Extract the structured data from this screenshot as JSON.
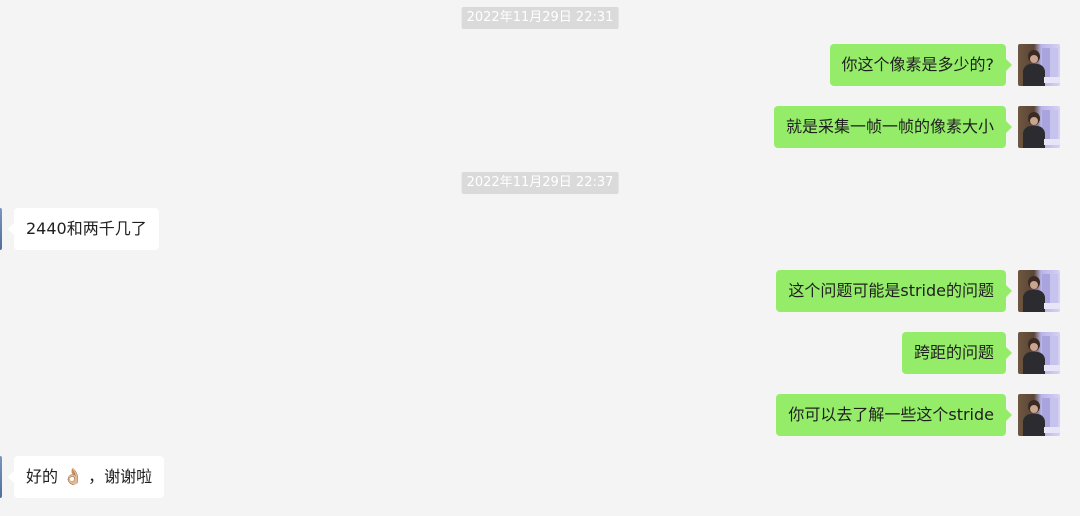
{
  "timestamps": [
    "2022年11月29日 22:31",
    "2022年11月29日 22:37"
  ],
  "messages": [
    {
      "side": "out",
      "text": "你这个像素是多少的?"
    },
    {
      "side": "out",
      "text": "就是采集一帧一帧的像素大小"
    },
    {
      "side": "in",
      "text": "2440和两千几了"
    },
    {
      "side": "out",
      "text": "这个问题可能是stride的问题"
    },
    {
      "side": "out",
      "text": "跨距的问题"
    },
    {
      "side": "out",
      "text": "你可以去了解一些这个stride"
    },
    {
      "side": "in",
      "text_before": "好的",
      "emoji": "👌🏼",
      "text_after": "，谢谢啦"
    }
  ],
  "colors": {
    "outgoing_bubble": "#95ec69",
    "incoming_bubble": "#ffffff",
    "background": "#f4f4f4",
    "timestamp_bg": "#dadada"
  }
}
